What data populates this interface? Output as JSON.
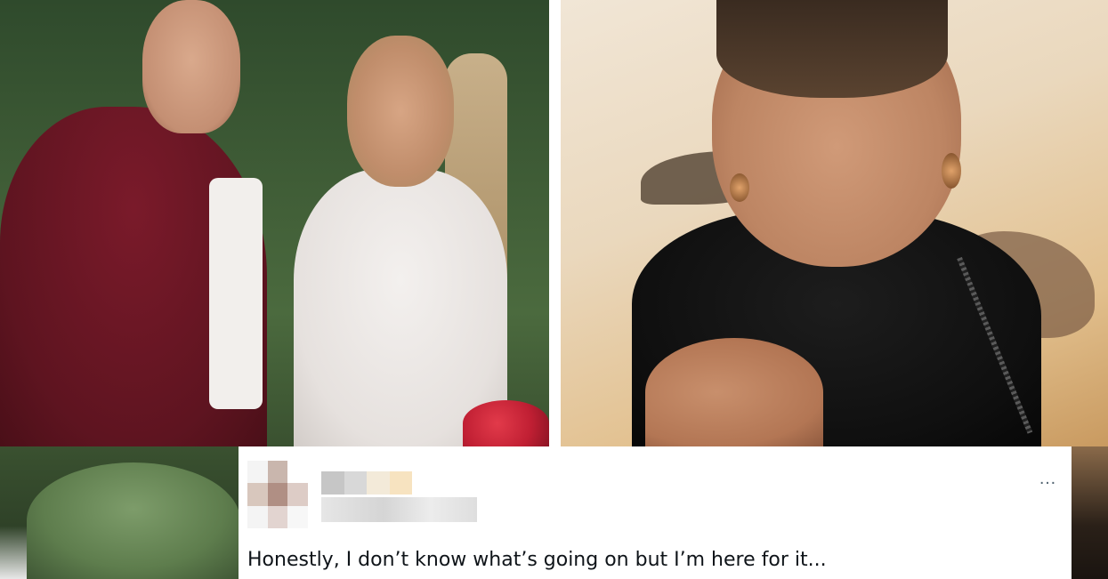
{
  "tweet": {
    "text": "Honestly, I don’t know what’s going on but I’m here for it...",
    "more_icon": "…",
    "avatar_pixels": [
      "#f4f4f4",
      "#c9b6ad",
      "#ffffff",
      "#d8c7bd",
      "#b08f84",
      "#ddccc6",
      "#f4f4f4",
      "#e2d4d0",
      "#f7f7f7"
    ],
    "name_pixels": [
      "#c6c6c6",
      "#d8d8d8",
      "#f3ead9",
      "#f7e3c0"
    ]
  },
  "colors": {
    "text": "#0f1419",
    "icon": "#536471",
    "background": "#ffffff"
  }
}
